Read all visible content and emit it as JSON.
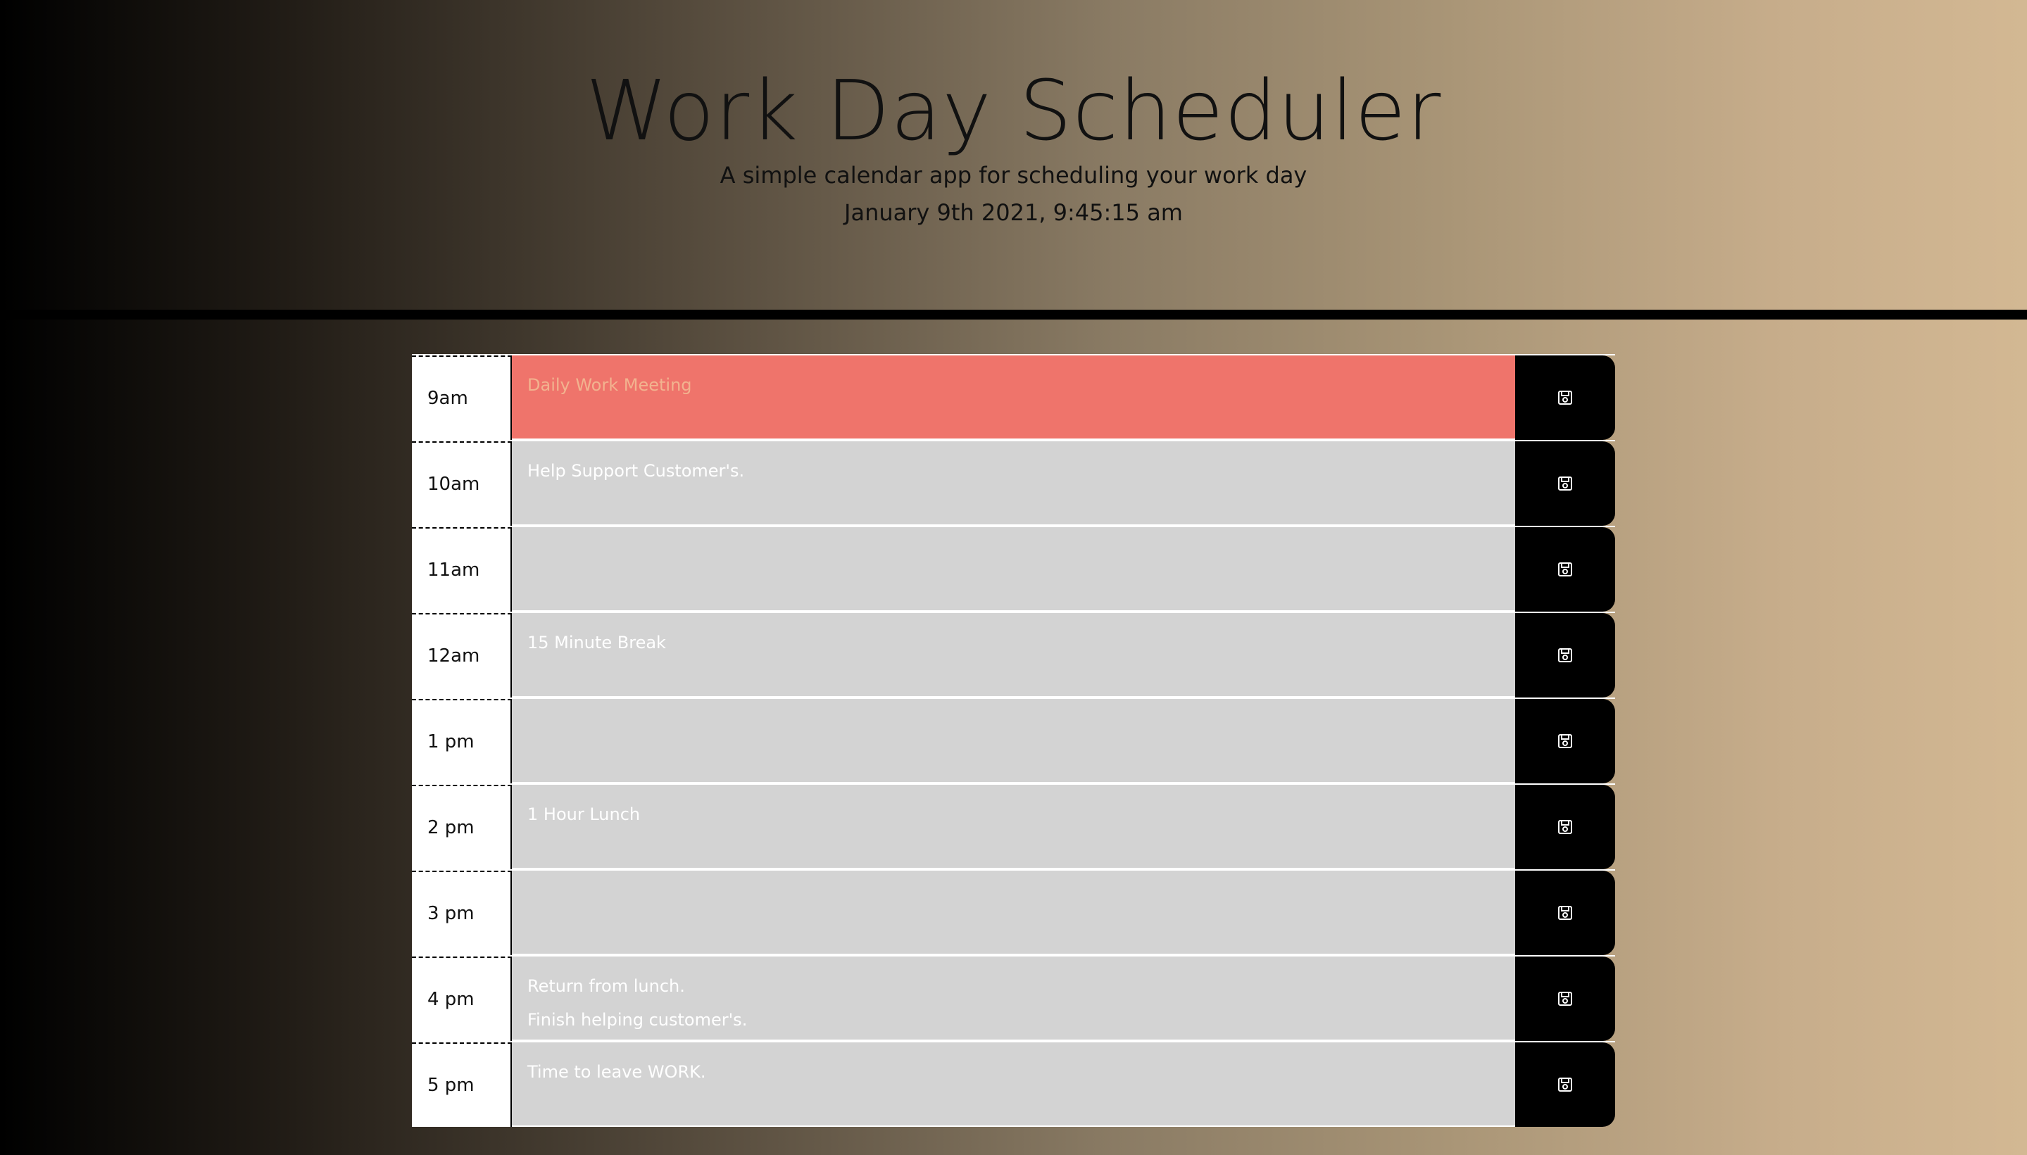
{
  "header": {
    "title": "Work Day Scheduler",
    "subtitle": "A simple calendar app for scheduling your work day",
    "datetime": "January 9th 2021, 9:45:15 am"
  },
  "rows": [
    {
      "hour": "9am",
      "description": "Daily Work Meeting",
      "state": "present"
    },
    {
      "hour": "10am",
      "description": "Help Support Customer's.",
      "state": "future"
    },
    {
      "hour": "11am",
      "description": "",
      "state": "future"
    },
    {
      "hour": "12am",
      "description": "15 Minute Break",
      "state": "future"
    },
    {
      "hour": "1 pm",
      "description": "",
      "state": "future"
    },
    {
      "hour": "2 pm",
      "description": "1 Hour Lunch",
      "state": "future"
    },
    {
      "hour": "3 pm",
      "description": "",
      "state": "future"
    },
    {
      "hour": "4 pm",
      "description": "Return from lunch.\nFinish helping customer's.",
      "state": "future"
    },
    {
      "hour": "5 pm",
      "description": "Time to leave WORK.",
      "state": "future"
    }
  ],
  "icons": {
    "save": "save-icon"
  },
  "colors": {
    "present": "#ef746b",
    "future": "#d3d3d3",
    "save_button": "#000000"
  }
}
